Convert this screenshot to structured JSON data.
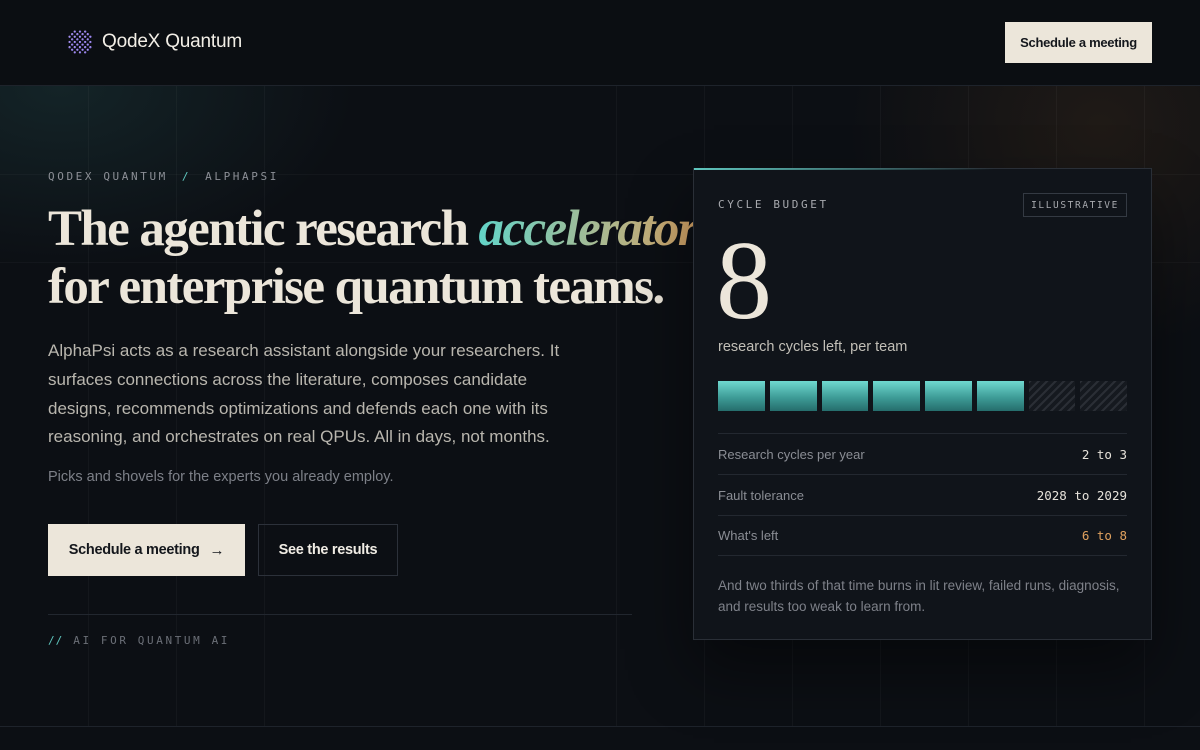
{
  "header": {
    "brand": "QodeX Quantum",
    "cta_label": "Schedule a meeting"
  },
  "hero": {
    "breadcrumb": {
      "part1": "QODEX QUANTUM",
      "sep": "/",
      "part2": "ALPHAPSI"
    },
    "headline": {
      "line1_pre": "The agentic research ",
      "line1_accent": "accelerator",
      "line2": "for enterprise quantum teams."
    },
    "description": "AlphaPsi acts as a research assistant alongside your researchers. It surfaces connections across the literature, composes candidate designs, recommends optimizations and defends each one with its reasoning, and orchestrates on real QPUs. All in days, not months.",
    "tagline": "Picks and shovels for the experts you already employ.",
    "primary_cta": {
      "label": "Schedule a meeting",
      "arrow": "→"
    },
    "secondary_cta": {
      "label": "See the results"
    },
    "footnote": {
      "slashes": "//",
      "text": "AI FOR QUANTUM AI"
    }
  },
  "card": {
    "label": "CYCLE BUDGET",
    "badge": "ILLUSTRATIVE",
    "number": "8",
    "subtitle": "research cycles left, per team",
    "cycles_total": 8,
    "cycles_filled": 6,
    "rows": [
      {
        "label": "Research cycles per year",
        "value": "2 to 3",
        "highlight": false
      },
      {
        "label": "Fault tolerance",
        "value": "2028 to 2029",
        "highlight": false
      },
      {
        "label": "What's left",
        "value": "6 to 8",
        "highlight": true
      }
    ],
    "note": "And two thirds of that time burns in lit review, failed runs, diagnosis, and results too weak to learn from."
  },
  "colors": {
    "accent_teal": "#5fc6be",
    "accent_amber": "#e0a15e",
    "cream": "#ece6da",
    "background": "#0c0f14"
  },
  "icons": {
    "logo": "qodex-lattice-logo-icon",
    "arrow": "arrow-right-icon"
  }
}
